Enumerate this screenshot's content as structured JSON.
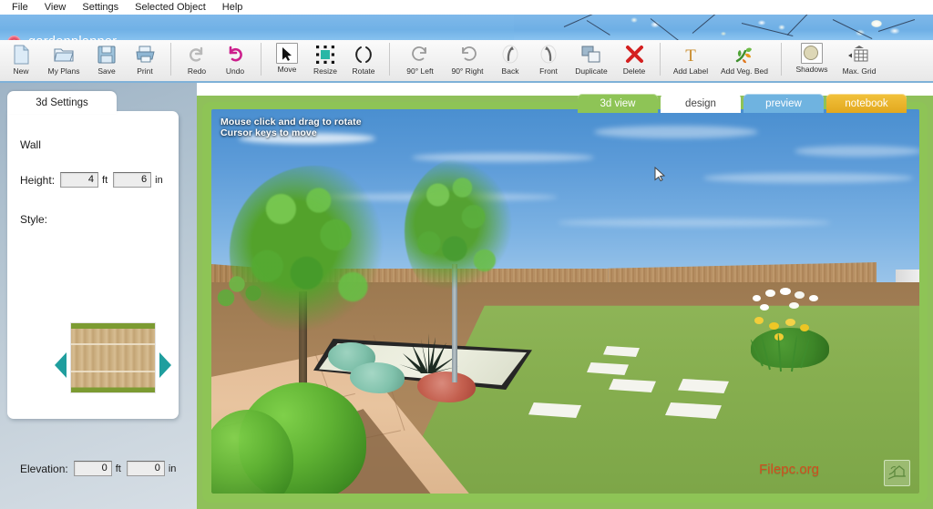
{
  "menubar": {
    "items": [
      {
        "label": "File"
      },
      {
        "label": "View"
      },
      {
        "label": "Settings"
      },
      {
        "label": "Selected Object"
      },
      {
        "label": "Help"
      }
    ]
  },
  "banner": {
    "logo_icon": "flower-logo-icon",
    "app_name": "gardenplanner",
    "background": "#6fb0e6"
  },
  "toolbar": {
    "groups": [
      {
        "tools": [
          {
            "label": "New",
            "icon": "new-document-icon",
            "framed": false
          },
          {
            "label": "My Plans",
            "icon": "open-folder-icon",
            "framed": false
          },
          {
            "label": "Save",
            "icon": "floppy-disk-icon",
            "framed": false
          },
          {
            "label": "Print",
            "icon": "printer-icon",
            "framed": false
          }
        ]
      },
      {
        "tools": [
          {
            "label": "Redo",
            "icon": "redo-arrow-icon",
            "framed": false
          },
          {
            "label": "Undo",
            "icon": "undo-arrow-icon",
            "framed": false
          }
        ]
      },
      {
        "tools": [
          {
            "label": "Move",
            "icon": "cursor-arrow-icon",
            "framed": true
          },
          {
            "label": "Resize",
            "icon": "resize-handles-icon",
            "framed": false
          },
          {
            "label": "Rotate",
            "icon": "rotate-brackets-icon",
            "framed": false
          }
        ]
      },
      {
        "tools": [
          {
            "label": "90° Left",
            "icon": "rotate-left-icon",
            "framed": false
          },
          {
            "label": "90° Right",
            "icon": "rotate-right-icon",
            "framed": false
          },
          {
            "label": "Back",
            "icon": "send-back-icon",
            "framed": false
          },
          {
            "label": "Front",
            "icon": "bring-front-icon",
            "framed": false
          },
          {
            "label": "Duplicate",
            "icon": "duplicate-icon",
            "framed": false
          },
          {
            "label": "Delete",
            "icon": "delete-cross-icon",
            "framed": false
          }
        ]
      },
      {
        "tools": [
          {
            "label": "Add Label",
            "icon": "text-label-icon",
            "framed": false
          },
          {
            "label": "Add Veg. Bed",
            "icon": "vegetable-bed-icon",
            "framed": false
          }
        ]
      },
      {
        "tools": [
          {
            "label": "Shadows",
            "icon": "shadow-sphere-icon",
            "framed": true
          },
          {
            "label": "Max. Grid",
            "icon": "grid-icon",
            "framed": false
          }
        ]
      }
    ]
  },
  "left_panel": {
    "tab_label": "3d Settings",
    "section_label": "Wall",
    "height": {
      "label": "Height:",
      "feet_value": "4",
      "feet_unit": "ft",
      "inches_value": "6",
      "inches_unit": "in"
    },
    "style": {
      "label": "Style:",
      "prev_icon": "arrow-left-icon",
      "next_icon": "arrow-right-icon",
      "preview_name": "wooden-fence-preview"
    },
    "elevation": {
      "label": "Elevation:",
      "feet_value": "0",
      "feet_unit": "ft",
      "inches_value": "0",
      "inches_unit": "in"
    }
  },
  "view_tabs": [
    {
      "label": "3d view",
      "active": true,
      "color": "#8ec456"
    },
    {
      "label": "design",
      "active": false,
      "color": "#ffffff"
    },
    {
      "label": "preview",
      "active": false,
      "color": "#6fb3e0"
    },
    {
      "label": "notebook",
      "active": false,
      "color": "#e8b229"
    }
  ],
  "viewport": {
    "hint_line1": "Mouse click and drag to rotate",
    "hint_line2": "Cursor keys to move",
    "watermark": "Filepc.org",
    "corner_button_icon": "garden-house-icon",
    "frame_color": "#8ec456"
  }
}
